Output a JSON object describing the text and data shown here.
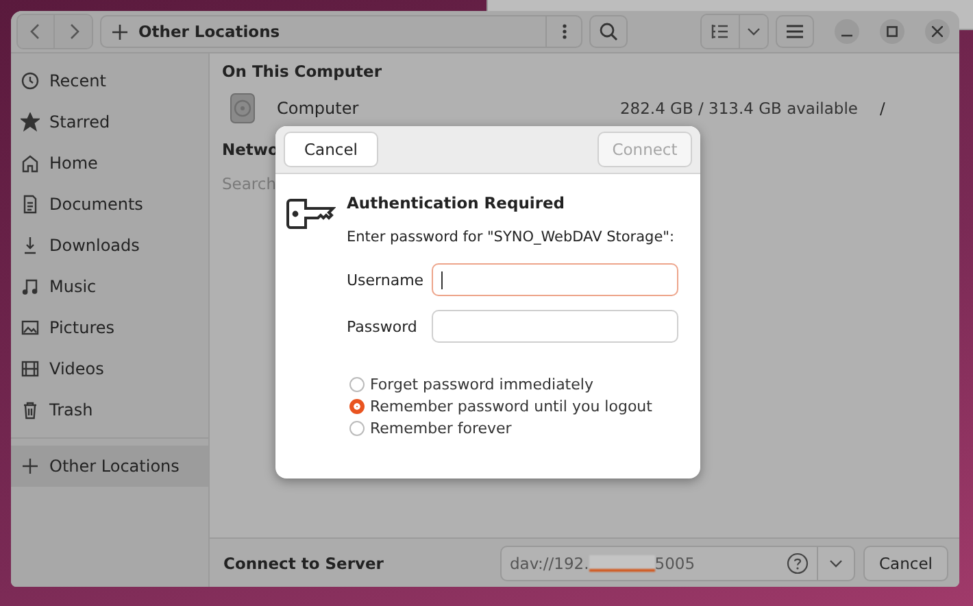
{
  "header": {
    "location": "Other Locations"
  },
  "sidebar": {
    "items": [
      {
        "label": "Recent",
        "kind": "recent",
        "selected": false
      },
      {
        "label": "Starred",
        "kind": "starred",
        "selected": false
      },
      {
        "label": "Home",
        "kind": "home",
        "selected": false
      },
      {
        "label": "Documents",
        "kind": "documents",
        "selected": false
      },
      {
        "label": "Downloads",
        "kind": "downloads",
        "selected": false
      },
      {
        "label": "Music",
        "kind": "music",
        "selected": false
      },
      {
        "label": "Pictures",
        "kind": "pictures",
        "selected": false
      },
      {
        "label": "Videos",
        "kind": "videos",
        "selected": false
      },
      {
        "label": "Trash",
        "kind": "trash",
        "selected": false
      },
      {
        "label": "Other Locations",
        "kind": "other",
        "selected": true
      }
    ]
  },
  "content": {
    "computer_heading": "On This Computer",
    "computer": {
      "name": "Computer",
      "usage": "282.4 GB / 313.4 GB available",
      "mount": "/"
    },
    "networks_heading": "Netwo",
    "search_hint": "Search"
  },
  "dialog": {
    "cancel": "Cancel",
    "connect": {
      "label": "Connect",
      "disabled": true
    },
    "title": "Authentication Required",
    "prompt": "Enter password for \"SYNO_WebDAV Storage\":",
    "fields": [
      {
        "label": "Username",
        "focused": true
      },
      {
        "label": "Password",
        "focused": false
      }
    ],
    "options": [
      {
        "label": "Forget password immediately",
        "selected": false
      },
      {
        "label": "Remember password until you logout",
        "selected": true
      },
      {
        "label": "Remember forever",
        "selected": false
      }
    ]
  },
  "footer": {
    "label": "Connect to Server",
    "address_start": "dav://192.",
    "address_end": "5005",
    "cancel": "Cancel"
  }
}
